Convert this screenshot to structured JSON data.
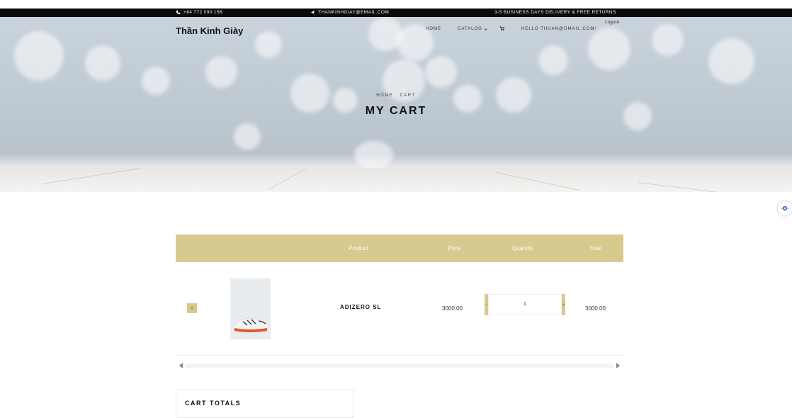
{
  "topbar": {
    "phone": "+84 772 090 156",
    "email": "THANKINHGIAY@EMAIL.COM",
    "shipping": "3-5 BUSINESS DAYS DELIVERY & FREE RETURNS"
  },
  "header": {
    "logo": "Thần Kinh Giày",
    "nav": {
      "home": "HOME",
      "catalog": "CATALOG",
      "user": "HELLO THUAN@GMAIL.COM!",
      "logout": "Logout"
    }
  },
  "hero": {
    "breadcrumb": [
      "HOME",
      "CART"
    ],
    "title": "MY CART"
  },
  "cart": {
    "headers": [
      "Product",
      "Price",
      "Quantity",
      "Total"
    ],
    "items": [
      {
        "remove": "×",
        "name": "ADIZERO SL",
        "price": "3000.00",
        "quantity": "1",
        "minus": "-",
        "plus": "+",
        "total": "3000.00"
      }
    ]
  },
  "totals": {
    "title": "CART TOTALS"
  },
  "colors": {
    "accent": "#d8ca8e",
    "topbar_bg": "#0b0b0b"
  },
  "icons": {
    "phone": "phone-icon",
    "email": "paper-plane-icon",
    "cart": "cart-icon",
    "catalog_caret": "chevron-down-icon",
    "floating": "accessibility-icon"
  }
}
